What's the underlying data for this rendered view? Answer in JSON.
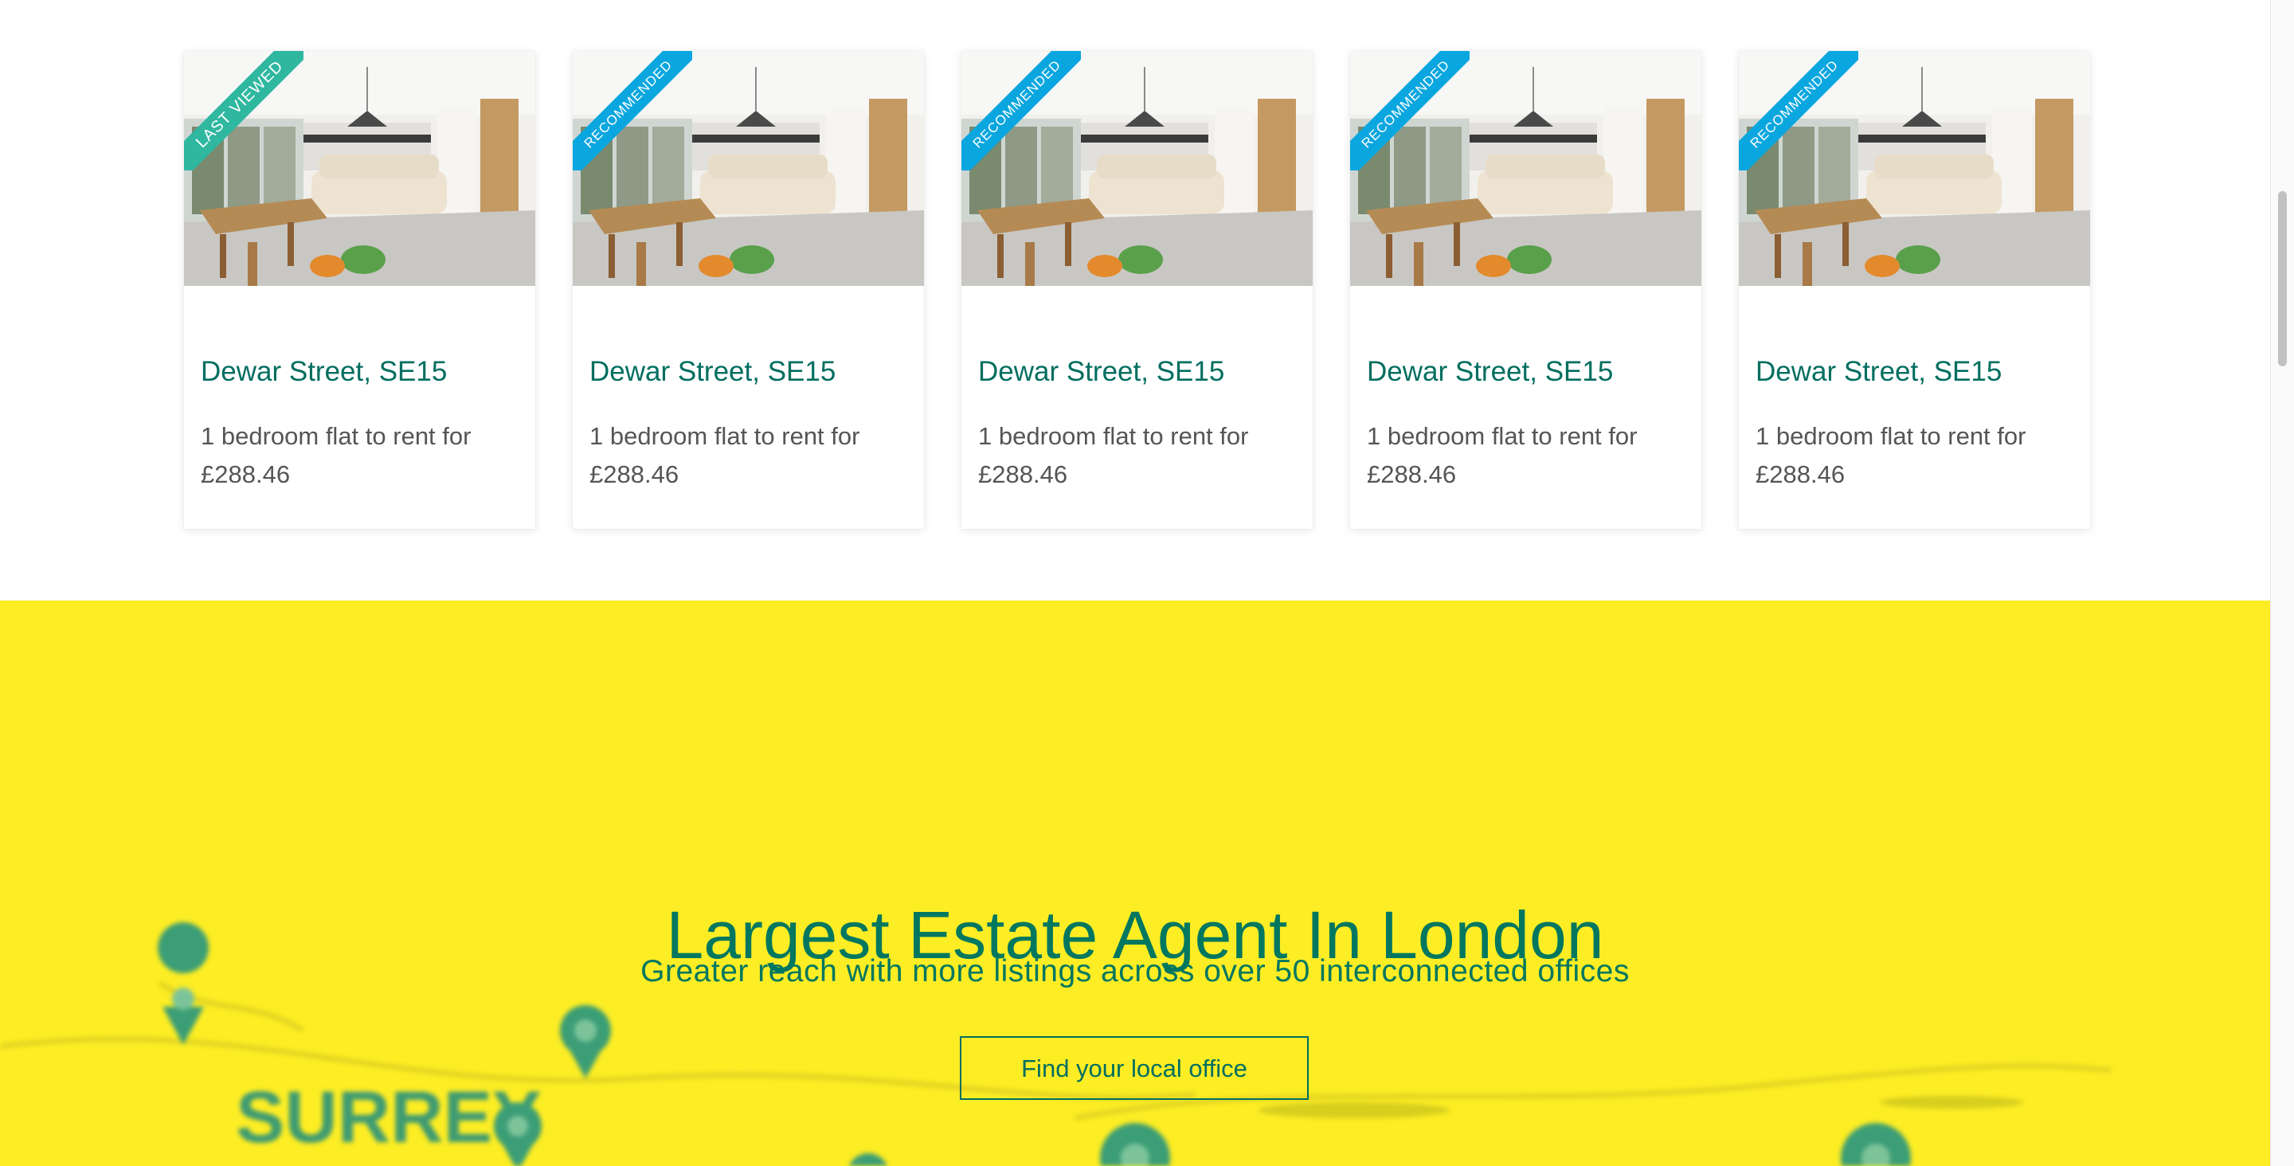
{
  "listings": [
    {
      "ribbon": "LAST VIEWED",
      "ribbon_type": "viewed",
      "title": "Dewar Street, SE15",
      "desc_line1": "1 bedroom flat to rent for",
      "desc_line2": "£288.46"
    },
    {
      "ribbon": "RECOMMENDED",
      "ribbon_type": "recommended",
      "title": "Dewar Street, SE15",
      "desc_line1": "1 bedroom flat to rent for",
      "desc_line2": "£288.46"
    },
    {
      "ribbon": "RECOMMENDED",
      "ribbon_type": "recommended",
      "title": "Dewar Street, SE15",
      "desc_line1": "1 bedroom flat to rent for",
      "desc_line2": "£288.46"
    },
    {
      "ribbon": "RECOMMENDED",
      "ribbon_type": "recommended",
      "title": "Dewar Street, SE15",
      "desc_line1": "1 bedroom flat to rent for",
      "desc_line2": "£288.46"
    },
    {
      "ribbon": "RECOMMENDED",
      "ribbon_type": "recommended",
      "title": "Dewar Street, SE15",
      "desc_line1": "1 bedroom flat to rent for",
      "desc_line2": "£288.46"
    }
  ],
  "promo": {
    "headline": "Largest Estate Agent In London",
    "subline": "Greater reach with more listings across over 50 interconnected offices",
    "button_label": "Find your local office",
    "map_label": "SURREY"
  },
  "colors": {
    "accent_green": "#006e5f",
    "promo_yellow": "#fced24",
    "ribbon_recommended": "#0aa6df",
    "ribbon_viewed": "#2fb7a0"
  }
}
